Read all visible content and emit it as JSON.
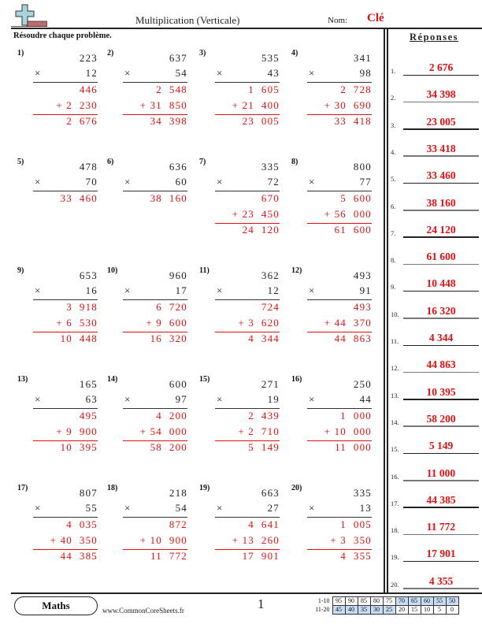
{
  "header": {
    "title": "Multiplication (Verticale)",
    "nom_label": "Nom:",
    "nom_value": "Clé",
    "instructions": "Résoudre chaque problème.",
    "logo_icon": "plus-minus-logo-icon"
  },
  "answers_title": "Réponses",
  "problems": [
    {
      "num": "1)",
      "top": "223",
      "mult": "12",
      "p1": "446",
      "p2": "+ 2  230",
      "result": "2  676",
      "partial": true
    },
    {
      "num": "2)",
      "top": "637",
      "mult": "54",
      "p1": "2  548",
      "p2": "+ 31  850",
      "result": "34  398",
      "partial": true
    },
    {
      "num": "3)",
      "top": "535",
      "mult": "43",
      "p1": "1  605",
      "p2": "+ 21  400",
      "result": "23  005",
      "partial": true
    },
    {
      "num": "4)",
      "top": "341",
      "mult": "98",
      "p1": "2  728",
      "p2": "+ 30  690",
      "result": "33  418",
      "partial": true
    },
    {
      "num": "5)",
      "top": "478",
      "mult": "70",
      "result": "33  460",
      "partial": false
    },
    {
      "num": "6)",
      "top": "636",
      "mult": "60",
      "result": "38  160",
      "partial": false
    },
    {
      "num": "7)",
      "top": "335",
      "mult": "72",
      "p1": "670",
      "p2": "+ 23  450",
      "result": "24  120",
      "partial": true
    },
    {
      "num": "8)",
      "top": "800",
      "mult": "77",
      "p1": "5  600",
      "p2": "+ 56  000",
      "result": "61  600",
      "partial": true
    },
    {
      "num": "9)",
      "top": "653",
      "mult": "16",
      "p1": "3  918",
      "p2": "+ 6  530",
      "result": "10  448",
      "partial": true
    },
    {
      "num": "10)",
      "top": "960",
      "mult": "17",
      "p1": "6  720",
      "p2": "+ 9  600",
      "result": "16  320",
      "partial": true
    },
    {
      "num": "11)",
      "top": "362",
      "mult": "12",
      "p1": "724",
      "p2": "+ 3  620",
      "result": "4  344",
      "partial": true
    },
    {
      "num": "12)",
      "top": "493",
      "mult": "91",
      "p1": "493",
      "p2": "+ 44  370",
      "result": "44  863",
      "partial": true
    },
    {
      "num": "13)",
      "top": "165",
      "mult": "63",
      "p1": "495",
      "p2": "+ 9  900",
      "result": "10  395",
      "partial": true
    },
    {
      "num": "14)",
      "top": "600",
      "mult": "97",
      "p1": "4  200",
      "p2": "+ 54  000",
      "result": "58  200",
      "partial": true
    },
    {
      "num": "15)",
      "top": "271",
      "mult": "19",
      "p1": "2  439",
      "p2": "+ 2  710",
      "result": "5  149",
      "partial": true
    },
    {
      "num": "16)",
      "top": "250",
      "mult": "44",
      "p1": "1  000",
      "p2": "+ 10  000",
      "result": "11  000",
      "partial": true
    },
    {
      "num": "17)",
      "top": "807",
      "mult": "55",
      "p1": "4  035",
      "p2": "+ 40  350",
      "result": "44  385",
      "partial": true
    },
    {
      "num": "18)",
      "top": "218",
      "mult": "54",
      "p1": "872",
      "p2": "+ 10  900",
      "result": "11  772",
      "partial": true
    },
    {
      "num": "19)",
      "top": "663",
      "mult": "27",
      "p1": "4  641",
      "p2": "+ 13  260",
      "result": "17  901",
      "partial": true
    },
    {
      "num": "20)",
      "top": "335",
      "mult": "13",
      "p1": "1  005",
      "p2": "+ 3  350",
      "result": "4  355",
      "partial": true
    }
  ],
  "times_symbol": "×",
  "answers": [
    {
      "num": "1.",
      "value": "2 676"
    },
    {
      "num": "2.",
      "value": "34 398"
    },
    {
      "num": "3.",
      "value": "23 005"
    },
    {
      "num": "4.",
      "value": "33 418"
    },
    {
      "num": "5.",
      "value": "33 460"
    },
    {
      "num": "6.",
      "value": "38 160"
    },
    {
      "num": "7.",
      "value": "24 120"
    },
    {
      "num": "8.",
      "value": "61 600"
    },
    {
      "num": "9.",
      "value": "10 448"
    },
    {
      "num": "10.",
      "value": "16 320"
    },
    {
      "num": "11.",
      "value": "4 344"
    },
    {
      "num": "12.",
      "value": "44 863"
    },
    {
      "num": "13.",
      "value": "10 395"
    },
    {
      "num": "14.",
      "value": "58 200"
    },
    {
      "num": "15.",
      "value": "5 149"
    },
    {
      "num": "16.",
      "value": "11 000"
    },
    {
      "num": "17.",
      "value": "44 385"
    },
    {
      "num": "18.",
      "value": "11 772"
    },
    {
      "num": "19.",
      "value": "17 901"
    },
    {
      "num": "20.",
      "value": "4 355"
    }
  ],
  "footer": {
    "badge": "Maths",
    "website": "www.CommonCoreSheets.fr",
    "page": "1",
    "score_rows": [
      {
        "label": "1-10",
        "values": [
          "95",
          "90",
          "85",
          "80",
          "75",
          "70",
          "65",
          "60",
          "55",
          "50"
        ],
        "highlight": [
          false,
          false,
          false,
          false,
          false,
          true,
          true,
          true,
          true,
          true
        ]
      },
      {
        "label": "11-20",
        "values": [
          "45",
          "40",
          "35",
          "30",
          "25",
          "20",
          "15",
          "10",
          "5",
          "0"
        ],
        "highlight": [
          true,
          true,
          true,
          true,
          true,
          false,
          false,
          false,
          false,
          false
        ]
      }
    ]
  },
  "colors": {
    "answer_red": "#e01010",
    "text": "#222222",
    "score_highlight": "#c8dcf5",
    "logo_plus": "#a9d4de",
    "logo_minus": "#c06b6b"
  }
}
